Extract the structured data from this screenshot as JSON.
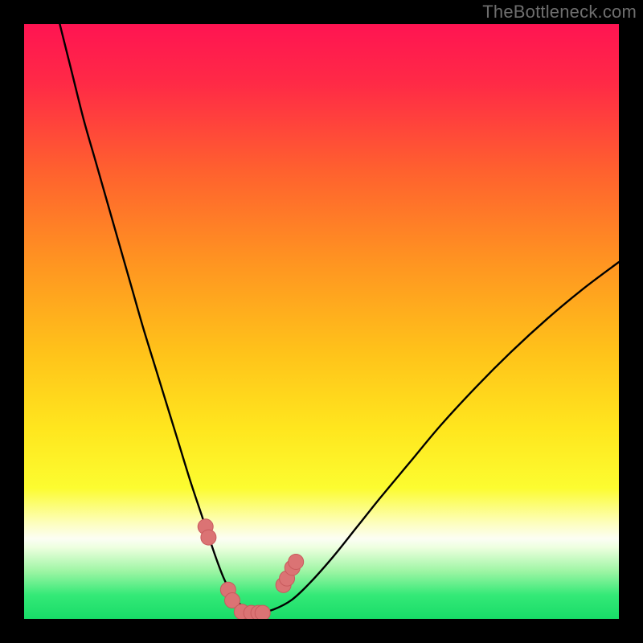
{
  "watermark": "TheBottleneck.com",
  "colors": {
    "frame": "#000000",
    "gradient_stops": [
      {
        "offset": 0.0,
        "color": "#ff1452"
      },
      {
        "offset": 0.1,
        "color": "#ff2a46"
      },
      {
        "offset": 0.25,
        "color": "#ff622e"
      },
      {
        "offset": 0.4,
        "color": "#ff9421"
      },
      {
        "offset": 0.55,
        "color": "#ffc21a"
      },
      {
        "offset": 0.68,
        "color": "#ffe61e"
      },
      {
        "offset": 0.78,
        "color": "#fcfc30"
      },
      {
        "offset": 0.84,
        "color": "#fdfec0"
      },
      {
        "offset": 0.865,
        "color": "#fcfef4"
      },
      {
        "offset": 0.88,
        "color": "#edffdf"
      },
      {
        "offset": 0.92,
        "color": "#9df5a4"
      },
      {
        "offset": 0.96,
        "color": "#34e977"
      },
      {
        "offset": 1.0,
        "color": "#18dc68"
      }
    ],
    "curve": "#000000",
    "marker_fill": "#db7374",
    "marker_stroke": "#c85a5d"
  },
  "chart_data": {
    "type": "line",
    "title": "",
    "xlabel": "",
    "ylabel": "",
    "xlim": [
      0,
      100
    ],
    "ylim": [
      0,
      100
    ],
    "series": [
      {
        "name": "bottleneck-curve",
        "x": [
          6,
          8,
          10,
          12,
          14,
          16,
          18,
          20,
          22,
          24,
          26,
          28,
          30,
          32,
          33.5,
          35,
          36.5,
          38,
          40,
          42,
          45,
          48,
          52,
          56,
          60,
          65,
          70,
          76,
          82,
          88,
          94,
          100
        ],
        "y": [
          100,
          92,
          84,
          77,
          70,
          63,
          56,
          49,
          42.5,
          36,
          29.5,
          23,
          17,
          11,
          7,
          4,
          2.3,
          1.4,
          1.2,
          1.6,
          3.2,
          6,
          10.5,
          15.5,
          20.5,
          26.5,
          32.5,
          39,
          45,
          50.5,
          55.5,
          60
        ]
      }
    ],
    "markers": {
      "name": "highlight-points",
      "x": [
        30.5,
        31,
        34.3,
        35,
        36.6,
        38.2,
        39.4,
        40.1,
        43.6,
        44.2,
        45.1,
        45.7
      ],
      "y": [
        15.5,
        13.7,
        4.9,
        3.1,
        1.2,
        1.0,
        1.0,
        1.0,
        5.7,
        6.8,
        8.6,
        9.6
      ]
    }
  }
}
